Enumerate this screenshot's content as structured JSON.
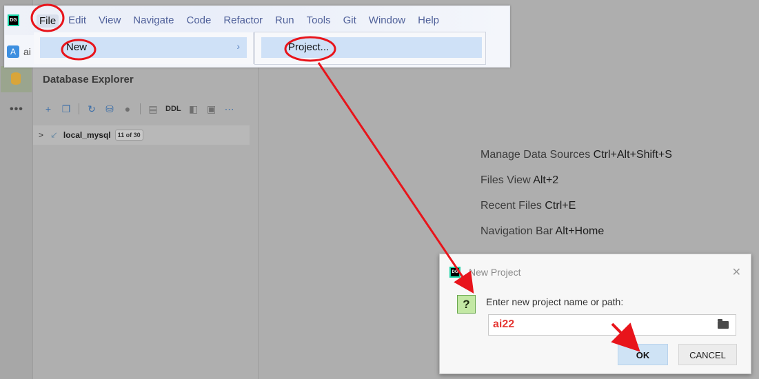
{
  "menubar": {
    "items": [
      {
        "label": "File"
      },
      {
        "label": "Edit"
      },
      {
        "label": "View"
      },
      {
        "label": "Navigate"
      },
      {
        "label": "Code"
      },
      {
        "label": "Refactor"
      },
      {
        "label": "Run"
      },
      {
        "label": "Tools"
      },
      {
        "label": "Git"
      },
      {
        "label": "Window"
      },
      {
        "label": "Help"
      }
    ],
    "active_item": "File"
  },
  "project": {
    "badge": "A",
    "name": "ai"
  },
  "file_menu": {
    "new_label": "New",
    "submenu_arrow": "›"
  },
  "new_submenu": {
    "project_label": "Project..."
  },
  "database_explorer": {
    "title": "Database Explorer",
    "toolbar_ddl": "DDL",
    "tree": {
      "label": "local_mysql",
      "badge": "11 of 30"
    }
  },
  "hints": [
    {
      "text": "Manage Data Sources",
      "key": "Ctrl+Alt+Shift+S"
    },
    {
      "text": "Files View",
      "key": "Alt+2"
    },
    {
      "text": "Recent Files",
      "key": "Ctrl+E"
    },
    {
      "text": "Navigation Bar",
      "key": "Alt+Home"
    }
  ],
  "dialog": {
    "title": "New Project",
    "prompt": "Enter new project name or path:",
    "input_value": "ai22",
    "ok_label": "OK",
    "cancel_label": "CANCEL"
  },
  "colors": {
    "highlight": "#cfe1f7",
    "annotation": "#e8141b",
    "input_text": "#e53935"
  }
}
